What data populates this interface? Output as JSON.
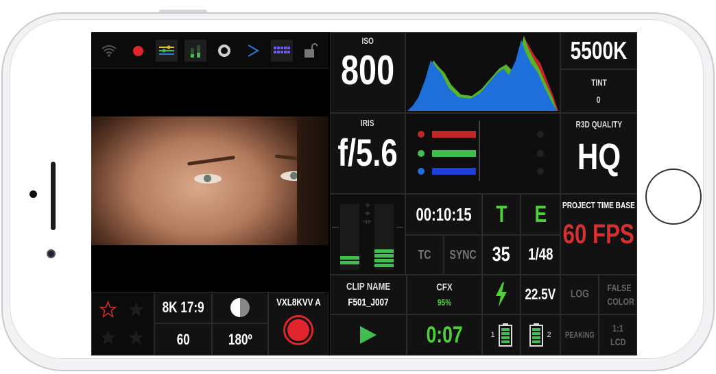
{
  "iso": {
    "label": "ISO",
    "value": "800"
  },
  "white_balance": {
    "value": "5500K",
    "tint_label": "TINT",
    "tint_value": "0"
  },
  "iris": {
    "label": "IRIS",
    "value": "f/5.6"
  },
  "r3d": {
    "label": "R3D QUALITY",
    "value": "HQ"
  },
  "audio": {
    "scale": [
      "-3-",
      "-9-",
      "-12-"
    ]
  },
  "timecode": {
    "value": "00:10:15",
    "tc_label": "TC",
    "sync_label": "SYNC"
  },
  "te": {
    "t": "T",
    "e": "E"
  },
  "shutter": {
    "fps_short": "35",
    "angle_frac": "1/48"
  },
  "project": {
    "label": "PROJECT TIME BASE",
    "value": "60 FPS"
  },
  "format": {
    "resolution": "8K 17:9",
    "fps": "60",
    "shutter_angle": "180º"
  },
  "reel": {
    "label": "VXL8KVV A"
  },
  "clip": {
    "label": "CLIP NAME",
    "value": "F501_J007"
  },
  "cfx": {
    "label": "CFX",
    "value": "95%"
  },
  "power": {
    "voltage": "22.5V"
  },
  "record_time": "0:07",
  "batteries": {
    "b1": "1",
    "b2": "2"
  },
  "toggles": {
    "log": "LOG",
    "false_color": "FALSE COLOR",
    "peaking": "PEAKING",
    "lcd": "1:1 LCD"
  },
  "colors": {
    "green": "#4cd137",
    "red": "#d63031",
    "blue": "#1e6fd9"
  }
}
